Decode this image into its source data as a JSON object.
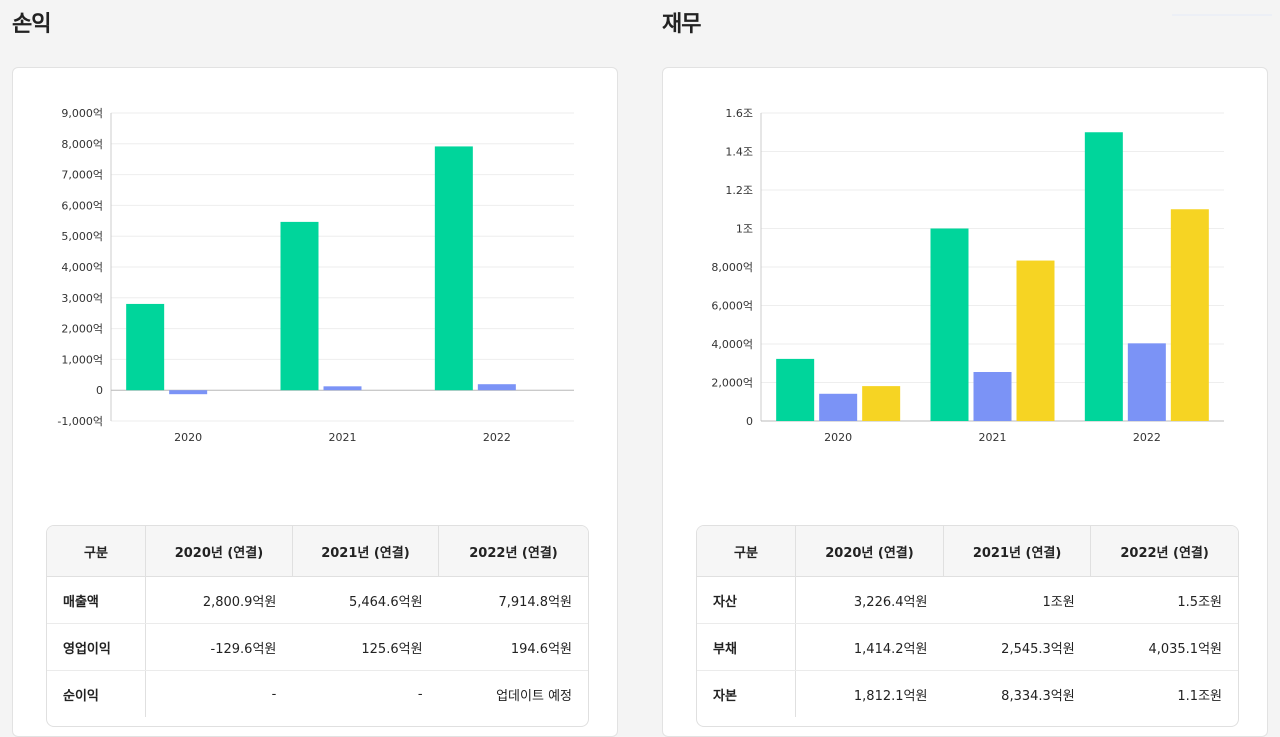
{
  "left": {
    "title": "손익",
    "table": {
      "headers": [
        "구분",
        "2020년 (연결)",
        "2021년 (연결)",
        "2022년 (연결)"
      ],
      "rows": [
        [
          "매출액",
          "2,800.9억원",
          "5,464.6억원",
          "7,914.8억원"
        ],
        [
          "영업이익",
          "-129.6억원",
          "125.6억원",
          "194.6억원"
        ],
        [
          "순이익",
          "-",
          "-",
          "업데이트 예정"
        ]
      ]
    }
  },
  "right": {
    "title": "재무",
    "table": {
      "headers": [
        "구분",
        "2020년 (연결)",
        "2021년 (연결)",
        "2022년 (연결)"
      ],
      "rows": [
        [
          "자산",
          "3,226.4억원",
          "1조원",
          "1.5조원"
        ],
        [
          "부채",
          "1,414.2억원",
          "2,545.3억원",
          "4,035.1억원"
        ],
        [
          "자본",
          "1,812.1억원",
          "8,334.3억원",
          "1.1조원"
        ]
      ]
    }
  },
  "chart_data": [
    {
      "type": "bar",
      "categories": [
        "2020",
        "2021",
        "2022"
      ],
      "series": [
        {
          "name": "매출액",
          "color": "#00d59b",
          "values": [
            2800.9,
            5464.6,
            7914.8
          ]
        },
        {
          "name": "영업이익",
          "color": "#7b93f6",
          "values": [
            -129.6,
            125.6,
            194.6
          ]
        },
        {
          "name": "순이익",
          "color": "#f6d423",
          "values": [
            0,
            0,
            0
          ]
        }
      ],
      "yticks": [
        -1000,
        0,
        1000,
        2000,
        3000,
        4000,
        5000,
        6000,
        7000,
        8000,
        9000
      ],
      "ytick_labels": [
        "-1,000억",
        "0",
        "1,000억",
        "2,000억",
        "3,000억",
        "4,000억",
        "5,000억",
        "6,000억",
        "7,000억",
        "8,000억",
        "9,000억"
      ],
      "ylim": [
        -1000,
        9000
      ],
      "grid": true,
      "legend": "bottom"
    },
    {
      "type": "bar",
      "categories": [
        "2020",
        "2021",
        "2022"
      ],
      "series": [
        {
          "name": "자산",
          "color": "#00d59b",
          "values": [
            3226.4,
            10000,
            15000
          ]
        },
        {
          "name": "부채",
          "color": "#7b93f6",
          "values": [
            1414.2,
            2545.3,
            4035.1
          ]
        },
        {
          "name": "자본",
          "color": "#f6d423",
          "values": [
            1812.1,
            8334.3,
            11000
          ]
        }
      ],
      "yticks": [
        0,
        2000,
        4000,
        6000,
        8000,
        10000,
        12000,
        14000,
        16000
      ],
      "ytick_labels": [
        "0",
        "2,000억",
        "4,000억",
        "6,000억",
        "8,000억",
        "1조",
        "1.2조",
        "1.4조",
        "1.6조"
      ],
      "ylim": [
        0,
        16000
      ],
      "grid": true,
      "legend": "bottom"
    }
  ]
}
